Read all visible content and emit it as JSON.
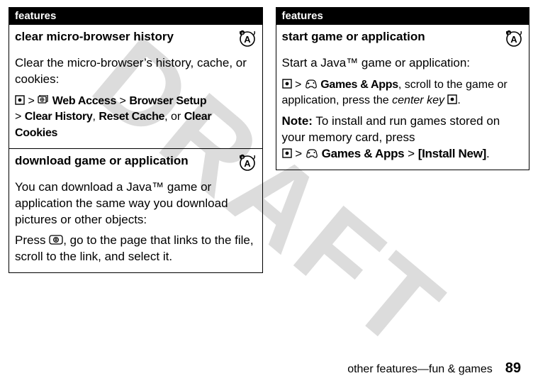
{
  "watermark": "DRAFT",
  "left": {
    "header": "features",
    "sections": [
      {
        "title": "clear micro-browser history",
        "desc": "Clear the micro-browser’s history, cache, or cookies:",
        "path_prefix": "",
        "path_items": {
          "web_access": "Web Access",
          "browser_setup": "Browser Setup",
          "clear_history": "Clear History",
          "reset_cache": "Reset Cache",
          "or": "or",
          "clear_cookies": "Clear Cookies"
        }
      },
      {
        "title": "download game or application",
        "desc": "You can download a Java™ game or application the same way you download pictures or other objects:",
        "press": "Press",
        "press_after": ", go to the page that links to the file, scroll to the link, and select it."
      }
    ]
  },
  "right": {
    "header": "features",
    "section": {
      "title": "start game or application",
      "desc": "Start a Java™ game or application:",
      "games_apps": "Games & Apps",
      "scroll_text": ", scroll to the game or application, press the ",
      "center_key": "center key",
      "note_label": "Note:",
      "note_text": " To install and run games stored on your memory card, press",
      "install_new": "[Install New]"
    }
  },
  "footer": {
    "section": "other features—fun & games",
    "page": "89"
  },
  "gt": ">"
}
